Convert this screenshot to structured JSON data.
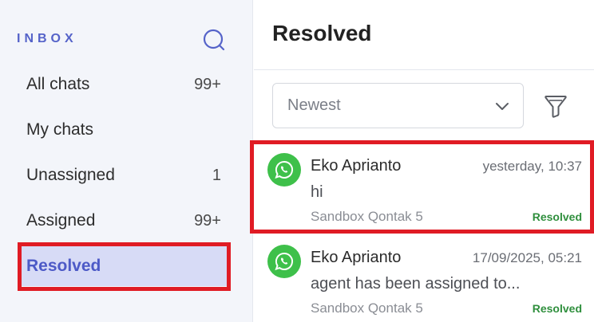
{
  "sidebar": {
    "title": "INBOX",
    "items": [
      {
        "label": "All chats",
        "count": "99+"
      },
      {
        "label": "My chats",
        "count": ""
      },
      {
        "label": "Unassigned",
        "count": "1"
      },
      {
        "label": "Assigned",
        "count": "99+"
      },
      {
        "label": "Resolved",
        "count": ""
      }
    ],
    "active_item": "Resolved"
  },
  "main": {
    "title": "Resolved",
    "sort": {
      "selected": "Newest"
    },
    "conversations": [
      {
        "name": "Eko Aprianto",
        "time": "yesterday, 10:37",
        "message": "hi",
        "channel": "Sandbox Qontak 5",
        "status": "Resolved"
      },
      {
        "name": "Eko Aprianto",
        "time": "17/09/2025, 05:21",
        "message": "agent has been assigned to...",
        "channel": "Sandbox Qontak 5",
        "status": "Resolved"
      }
    ]
  },
  "icons": {
    "search": "search-icon",
    "filter": "filter-icon",
    "chevron": "chevron-down-icon",
    "whatsapp": "whatsapp-icon"
  },
  "colors": {
    "accent": "#5563c9",
    "active_bg": "#d7dbf6",
    "whatsapp_green": "#3ec04a",
    "resolved_green": "#2f8f3d",
    "highlight_red": "#e01b24"
  }
}
